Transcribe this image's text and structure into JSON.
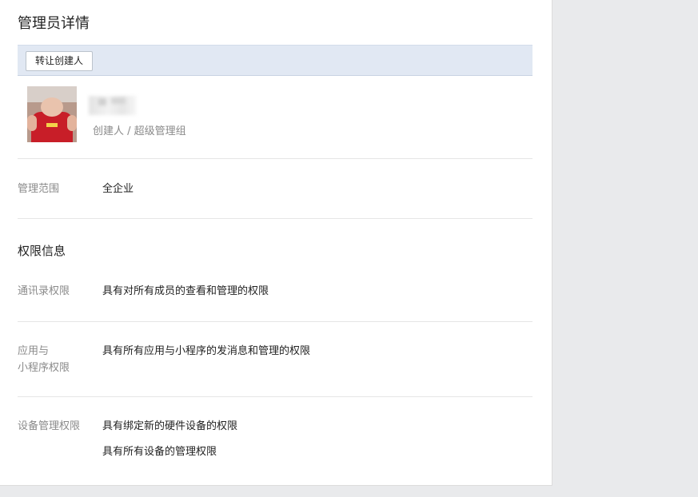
{
  "page": {
    "title": "管理员详情"
  },
  "toolbar": {
    "transfer_label": "转让创建人"
  },
  "profile": {
    "avatar_icon": "user-avatar-photo",
    "role_text": "创建人 / 超级管理组"
  },
  "scope": {
    "label": "管理范围",
    "value": "全企业"
  },
  "permissions": {
    "section_title": "权限信息",
    "contacts": {
      "label": "通讯录权限",
      "value": "具有对所有成员的查看和管理的权限"
    },
    "apps": {
      "label_line1": "应用与",
      "label_line2": "小程序权限",
      "value": "具有所有应用与小程序的发消息和管理的权限"
    },
    "devices": {
      "label": "设备管理权限",
      "value_line1": "具有绑定新的硬件设备的权限",
      "value_line2": "具有所有设备的管理权限"
    }
  }
}
